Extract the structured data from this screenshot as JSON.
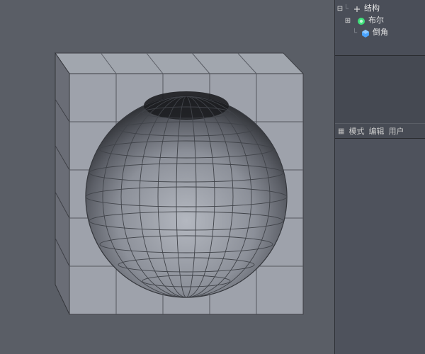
{
  "hierarchy": {
    "root_label": "结构",
    "children": [
      {
        "label": "布尔"
      },
      {
        "label": "倒角"
      }
    ]
  },
  "attr_tabs": {
    "mode": "模式",
    "edit": "编辑",
    "user": "用户"
  },
  "colors": {
    "bool_icon": "#3fe07a",
    "bevel_icon": "#4aa3ff"
  }
}
